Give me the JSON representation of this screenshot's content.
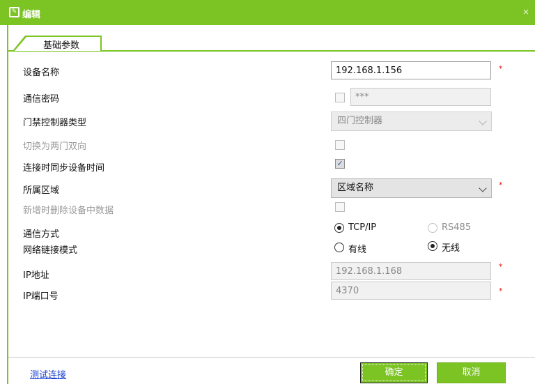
{
  "window": {
    "title": "编辑",
    "close_glyph": "×",
    "title_icon": "edit-icon"
  },
  "tabs": [
    {
      "label": "基础参数",
      "active": true
    }
  ],
  "fields": {
    "device_name": {
      "label": "设备名称",
      "value": "192.168.1.156",
      "required": "*"
    },
    "comm_password": {
      "label": "通信密码",
      "value": "***",
      "checked": false
    },
    "controller_type": {
      "label": "门禁控制器类型",
      "value": "四门控制器"
    },
    "switch_two_door": {
      "label": "切换为两门双向",
      "checked": false
    },
    "sync_time": {
      "label": "连接时同步设备时间",
      "checked": true,
      "check_glyph": "✓"
    },
    "area": {
      "label": "所属区域",
      "value": "区域名称",
      "required": "*"
    },
    "delete_data": {
      "label": "新增时删除设备中数据",
      "checked": false
    },
    "comm_mode": {
      "label": "通信方式",
      "options": [
        {
          "label": "TCP/IP",
          "selected": true
        },
        {
          "label": "RS485",
          "selected": false
        }
      ]
    },
    "network_mode": {
      "label": "网络链接模式",
      "options": [
        {
          "label": "有线",
          "selected": false
        },
        {
          "label": "无线",
          "selected": true
        }
      ]
    },
    "ip_address": {
      "label": "IP地址",
      "value": "192.168.1.168",
      "required": "*"
    },
    "ip_port": {
      "label": "IP端口号",
      "value": "4370",
      "required": "*"
    }
  },
  "footer": {
    "test_link": "测试连接",
    "ok": "确定",
    "cancel": "取消"
  },
  "colors": {
    "accent": "#7cc324",
    "required": "#e01818",
    "link": "#1a3fd0"
  }
}
